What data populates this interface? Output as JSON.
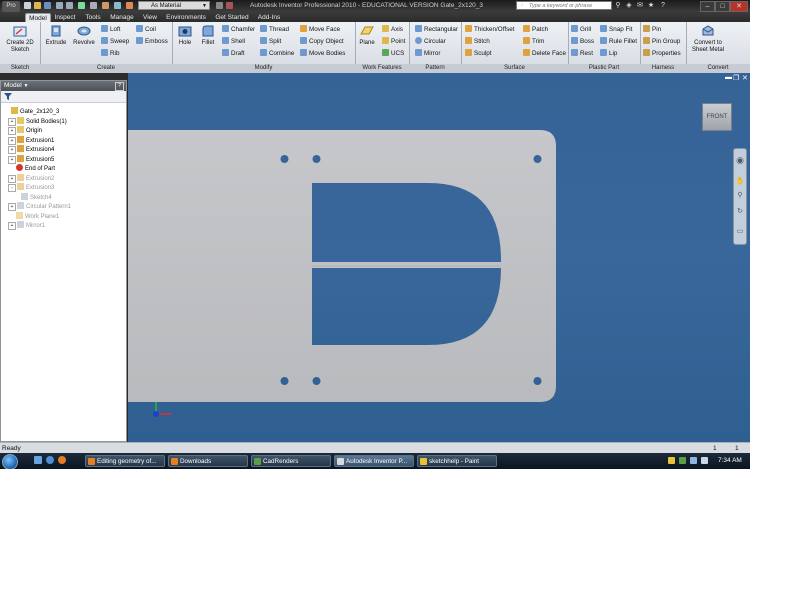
{
  "titlebar": {
    "app_button": "Pro",
    "material": "As Material",
    "title": "Autodesk Inventor Professional 2010 - EDUCATIONAL VERSION    Gate_2x120_3",
    "search_placeholder": "Type a keyword or phrase"
  },
  "tabs": [
    "Model",
    "Inspect",
    "Tools",
    "Manage",
    "View",
    "Environments",
    "Get Started",
    "Add-Ins"
  ],
  "ribbon": {
    "sketch": {
      "title": "Sketch",
      "create_2d": "Create 2D Sketch"
    },
    "create": {
      "title": "Create",
      "extrude": "Extrude",
      "revolve": "Revolve",
      "loft": "Loft",
      "sweep": "Sweep",
      "rib": "Rib",
      "coil": "Coil",
      "emboss": "Emboss"
    },
    "modify": {
      "title": "Modify",
      "hole": "Hole",
      "fillet": "Fillet",
      "chamfer": "Chamfer",
      "shell": "Shell",
      "draft": "Draft",
      "thread": "Thread",
      "split": "Split",
      "combine": "Combine",
      "move_face": "Move Face",
      "copy_object": "Copy Object",
      "move_bodies": "Move Bodies"
    },
    "work_features": {
      "title": "Work Features",
      "plane": "Plane",
      "axis": "Axis",
      "point": "Point",
      "ucs": "UCS"
    },
    "pattern": {
      "title": "Pattern",
      "rectangular": "Rectangular",
      "circular": "Circular",
      "mirror": "Mirror"
    },
    "surface": {
      "title": "Surface",
      "thicken": "Thicken/Offset",
      "stitch": "Stitch",
      "sculpt": "Sculpt",
      "patch": "Patch",
      "trim": "Trim",
      "delete_face": "Delete Face"
    },
    "plastic_part": {
      "title": "Plastic Part",
      "grill": "Grill",
      "boss": "Boss",
      "rest": "Rest",
      "snap_fit": "Snap Fit",
      "rule_fillet": "Rule Fillet",
      "lip": "Lip"
    },
    "harness": {
      "title": "Harness",
      "pin": "Pin",
      "pin_group": "Pin Group",
      "properties": "Properties"
    },
    "convert": {
      "title": "Convert",
      "sheet_metal": "Convert to Sheet Metal"
    }
  },
  "browser": {
    "title": "Model",
    "help": "?",
    "tree": [
      {
        "label": "Gate_2x120_3",
        "indent": 0,
        "dim": false,
        "icon": "part-icon",
        "expand": ""
      },
      {
        "label": "Solid Bodies(1)",
        "indent": 1,
        "dim": false,
        "icon": "folder-icon",
        "expand": "+"
      },
      {
        "label": "Origin",
        "indent": 1,
        "dim": false,
        "icon": "folder-icon",
        "expand": "+"
      },
      {
        "label": "Extrusion1",
        "indent": 1,
        "dim": false,
        "icon": "extrude-icon",
        "expand": "+"
      },
      {
        "label": "Extrusion4",
        "indent": 1,
        "dim": false,
        "icon": "extrude-icon",
        "expand": "+"
      },
      {
        "label": "Extrusion5",
        "indent": 1,
        "dim": false,
        "icon": "extrude-icon",
        "expand": "+"
      },
      {
        "label": "End of Part",
        "indent": 1,
        "dim": false,
        "icon": "end-of-part-icon",
        "expand": ""
      },
      {
        "label": "Extrusion2",
        "indent": 1,
        "dim": true,
        "icon": "extrude-icon",
        "expand": "+"
      },
      {
        "label": "Extrusion3",
        "indent": 1,
        "dim": true,
        "icon": "extrude-icon",
        "expand": "-"
      },
      {
        "label": "Sketch4",
        "indent": 2,
        "dim": true,
        "icon": "sketch-icon",
        "expand": ""
      },
      {
        "label": "Circular Pattern1",
        "indent": 1,
        "dim": true,
        "icon": "pattern-icon",
        "expand": "+"
      },
      {
        "label": "Work Plane1",
        "indent": 1,
        "dim": true,
        "icon": "workplane-icon",
        "expand": ""
      },
      {
        "label": "Mirror1",
        "indent": 1,
        "dim": true,
        "icon": "mirror-icon",
        "expand": "+"
      }
    ]
  },
  "viewcube": {
    "face": "FRONT"
  },
  "status": {
    "left": "Ready",
    "count1": "1",
    "count2": "1"
  },
  "taskbar": {
    "items": [
      "Editing geometry of...",
      "Downloads",
      "CadRenders",
      "Autodesk Inventor P...",
      "sketchhelp - Paint"
    ],
    "active_index": 3,
    "clock": "7:34 AM"
  },
  "colors": {
    "viewport_bg": "#36659a",
    "plate": "#c2c3c6",
    "ribbon": "#e4e8ed",
    "accent_blue": "#1f5ea8"
  }
}
